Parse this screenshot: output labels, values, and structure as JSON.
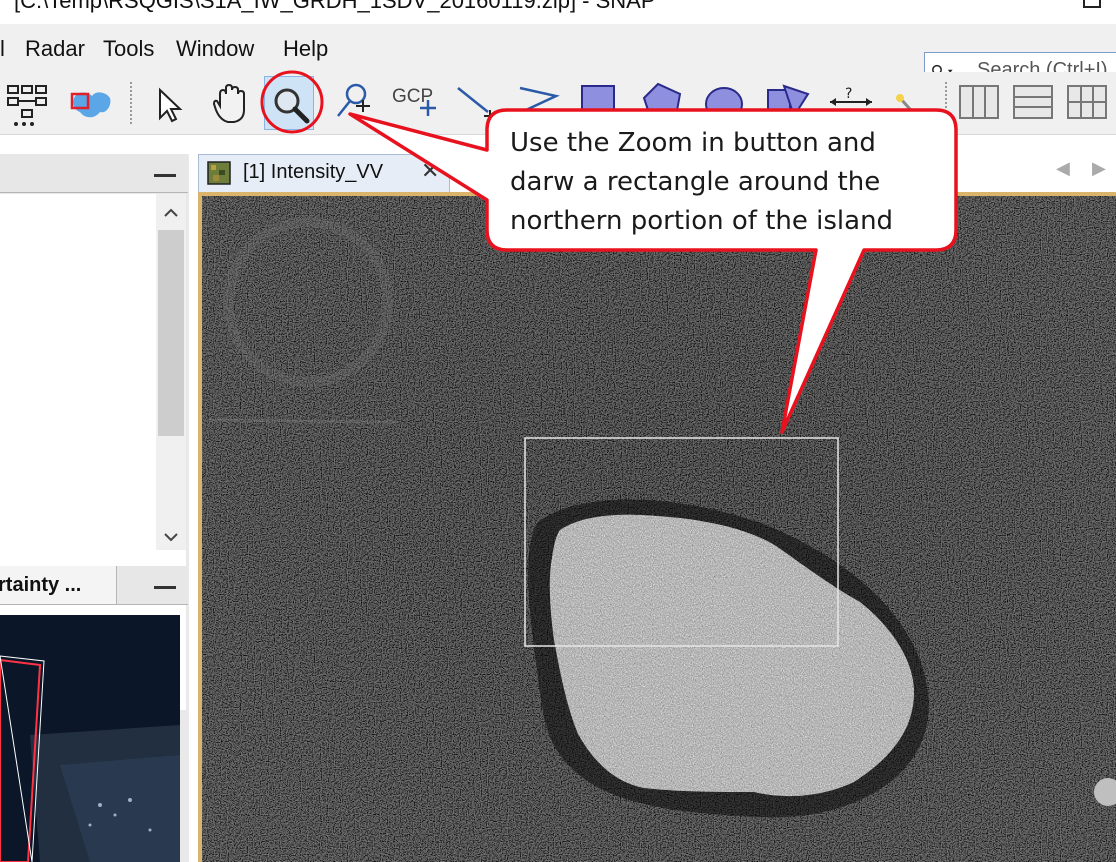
{
  "window": {
    "title": "[C:\\Temp\\RSQGIS\\S1A_IW_GRDH_1SDV_20160119.zip] - SNAP"
  },
  "menubar": {
    "items": [
      "l",
      "Radar",
      "Tools",
      "Window",
      "Help"
    ]
  },
  "search": {
    "placeholder": "Search (Ctrl+I)"
  },
  "toolbar": {
    "gcp_label": "GCP"
  },
  "left_panel": {
    "world_map_tab_label": "rtainty ..."
  },
  "document": {
    "tab_label": "[1] Intensity_VV",
    "close_glyph": "✕"
  },
  "callout": {
    "lines": [
      "Use the Zoom in button and",
      "darw a rectangle around the",
      "northern portion of the island"
    ]
  },
  "colors": {
    "accent": "#e8121e",
    "image_frame": "#d9b46a",
    "active_tool_bg": "#cfe3f7"
  }
}
